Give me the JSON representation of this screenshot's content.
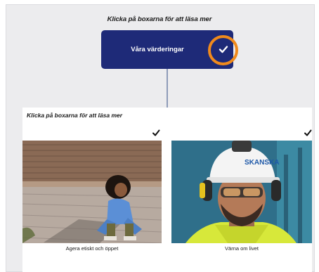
{
  "top_instruction": "Klicka på boxarna för att läsa mer",
  "values_box": {
    "label": "Våra värderingar"
  },
  "panel": {
    "instruction": "Klicka på boxarna för att läsa mer",
    "cards": [
      {
        "caption": "Agera etiskt och öppet",
        "icon": "check-icon"
      },
      {
        "caption": "Värna om livet",
        "icon": "check-icon",
        "helmet_text": "SKANSKA"
      }
    ]
  },
  "colors": {
    "accent_navy": "#1e2a78",
    "highlight_orange": "#f08a1c",
    "connector": "#8e9bb8"
  }
}
